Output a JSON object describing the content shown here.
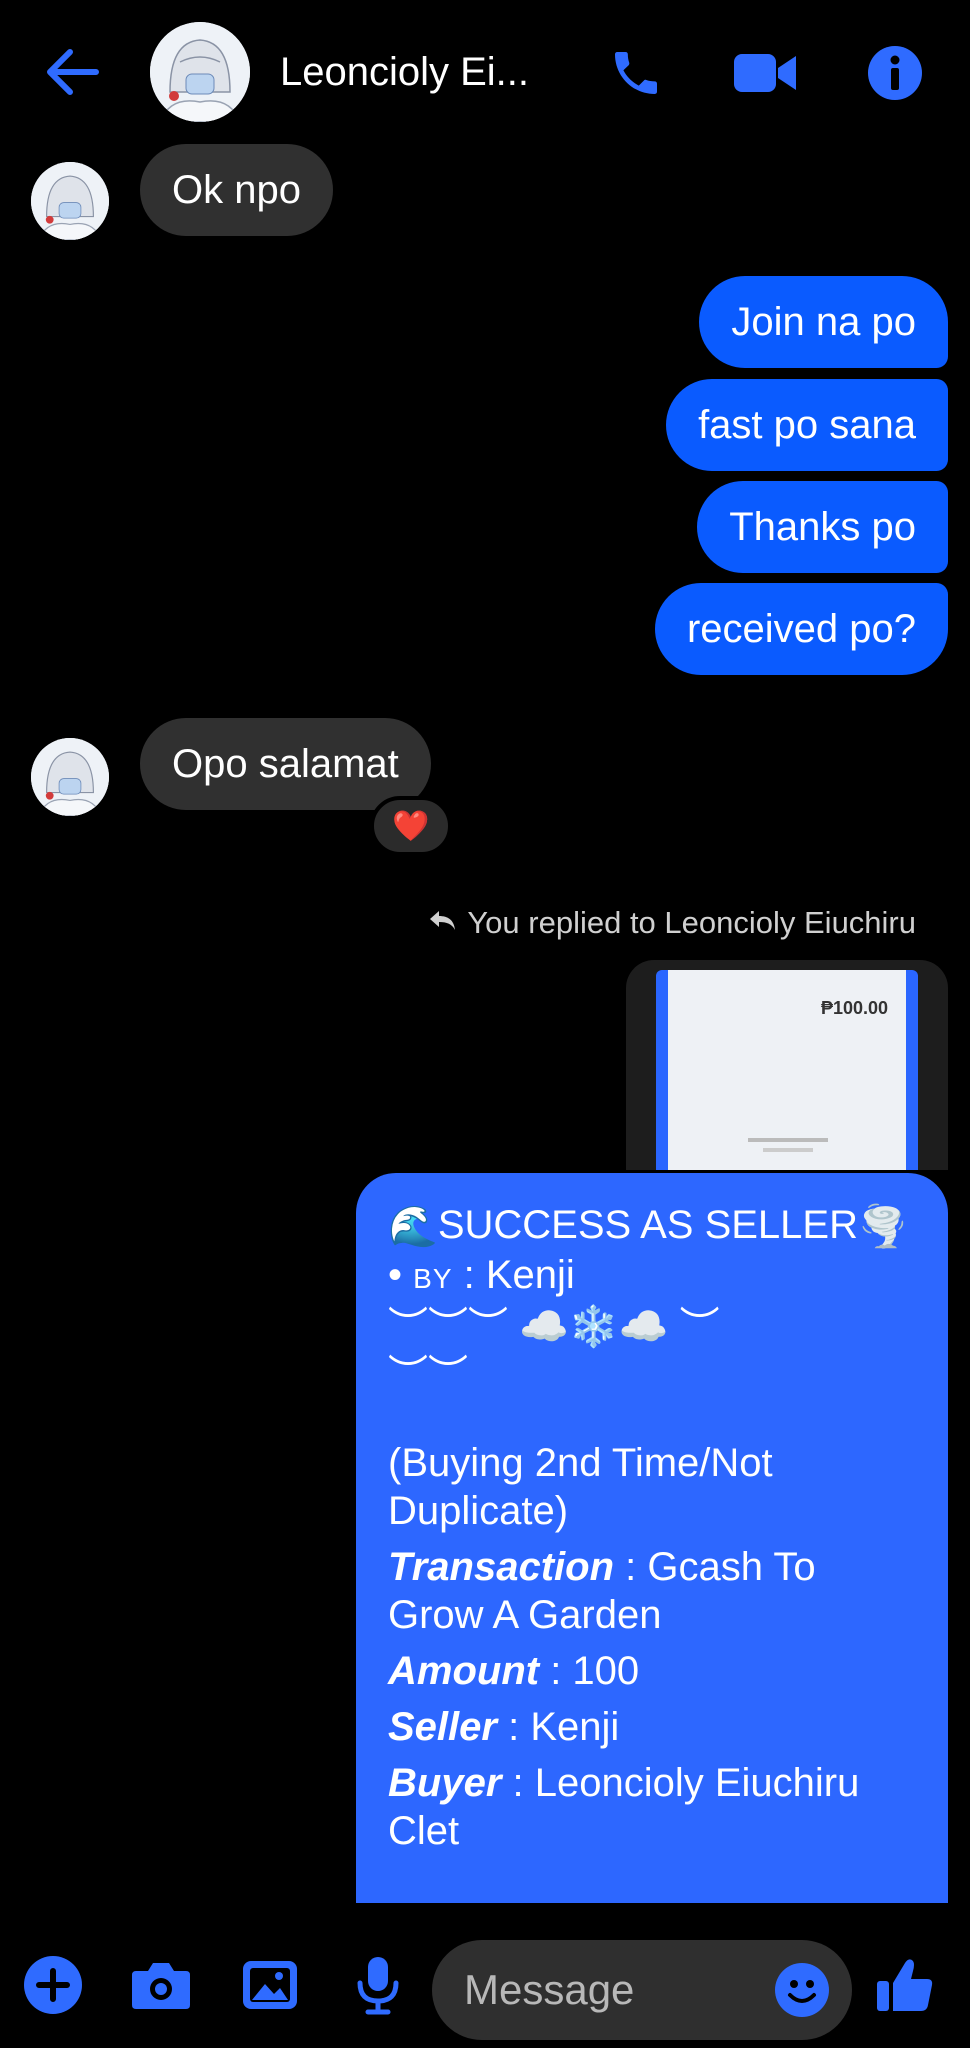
{
  "header": {
    "contact_name": "Leoncioly Ei...",
    "icons": [
      "back-arrow-icon",
      "phone-icon",
      "video-camera-icon",
      "info-icon"
    ]
  },
  "messages": {
    "in_1": "Ok npo",
    "out_1": "Join na po",
    "out_2": "fast po sana",
    "out_3": "Thanks po",
    "out_4": "received po?",
    "in_2": "Opo salamat",
    "reaction": "❤️"
  },
  "reply_note": "You replied to Leoncioly Eiuchiru",
  "attachment": {
    "amount": "₱100.00"
  },
  "card": {
    "line1_emoji_left": "🌊",
    "line1_text": "SUCCESS AS SELLER",
    "line1_emoji_right": "🌪️",
    "line2_bullet": "•",
    "line2_by": "BY",
    "line2_rest": ": Kenji",
    "deco1": "︶︶︶ ☁️❄️☁️ ︶",
    "deco2": "︶︶",
    "para1": "(Buying 2nd Time/Not Duplicate)",
    "transaction_label": "Transaction",
    "transaction_value": ": Gcash To Grow A Garden",
    "amount_label": "Amount",
    "amount_value": ": 100",
    "seller_label": "Seller",
    "seller_value": ": Kenji",
    "buyer_label": "Buyer",
    "buyer_value": ": Leoncioly Eiuchiru Clet"
  },
  "composer": {
    "placeholder": "Message",
    "icons": [
      "plus-icon",
      "camera-icon",
      "gallery-icon",
      "microphone-icon",
      "emoji-icon",
      "thumbs-up-icon"
    ]
  },
  "colors": {
    "accent": "#0a5bff",
    "card": "#2d67ff",
    "incoming": "#303030",
    "background": "#000000"
  }
}
